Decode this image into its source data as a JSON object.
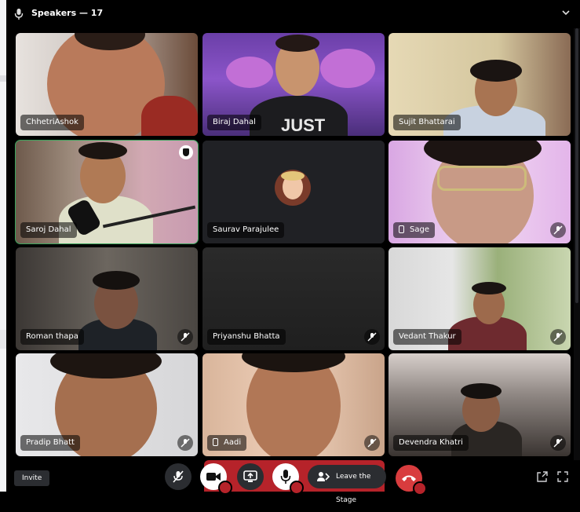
{
  "header": {
    "title": "Speakers — 17"
  },
  "tiles": [
    {
      "name": "ChhetriAshok"
    },
    {
      "name": "Biraj Dahal"
    },
    {
      "name": "Sujit Bhattarai"
    },
    {
      "name": "Saroj Dahal"
    },
    {
      "name": "Saurav Parajulee"
    },
    {
      "name": "Sage"
    },
    {
      "name": "Roman thapa"
    },
    {
      "name": "Priyanshu Bhatta"
    },
    {
      "name": "Vedant Thakur"
    },
    {
      "name": "Pradip Bhatt"
    },
    {
      "name": "Aadi"
    },
    {
      "name": "Devendra Khatri"
    }
  ],
  "shirt_text": "JUST",
  "controls": {
    "invite_label": "Invite",
    "leave_label": "Leave the Stage"
  },
  "colors": {
    "selected_outline": "#3ba55d",
    "danger": "#b6232a",
    "button": "#2b2d31"
  },
  "icons": [
    "microphone-icon",
    "chevron-down-icon",
    "microphone-off-icon",
    "mobile-device-icon",
    "moderator-shield-icon",
    "camera-icon",
    "screen-share-icon",
    "stage-leave-icon",
    "hang-up-icon",
    "popout-icon",
    "fullscreen-icon"
  ]
}
